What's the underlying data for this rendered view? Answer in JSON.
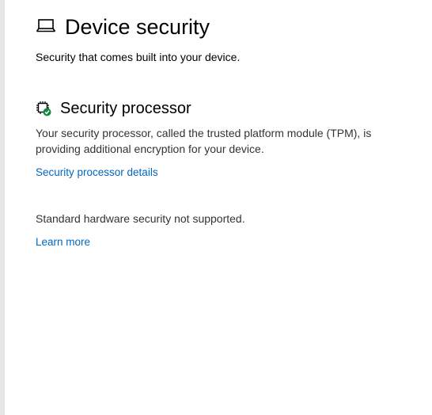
{
  "header": {
    "icon": "laptop-icon",
    "title": "Device security",
    "subtitle": "Security that comes built into your device."
  },
  "security_processor": {
    "icon": "chip-with-checkmark-icon",
    "title": "Security processor",
    "description": "Your security processor, called the trusted platform module (TPM), is providing additional encryption for your device.",
    "details_link": "Security processor details",
    "status_color": "#10893e"
  },
  "hardware_security": {
    "status": "Standard hardware security not supported.",
    "learn_more_link": "Learn more"
  },
  "colors": {
    "link": "#0067c0",
    "body_text": "#333333",
    "left_edge": "#e6e6e6"
  }
}
